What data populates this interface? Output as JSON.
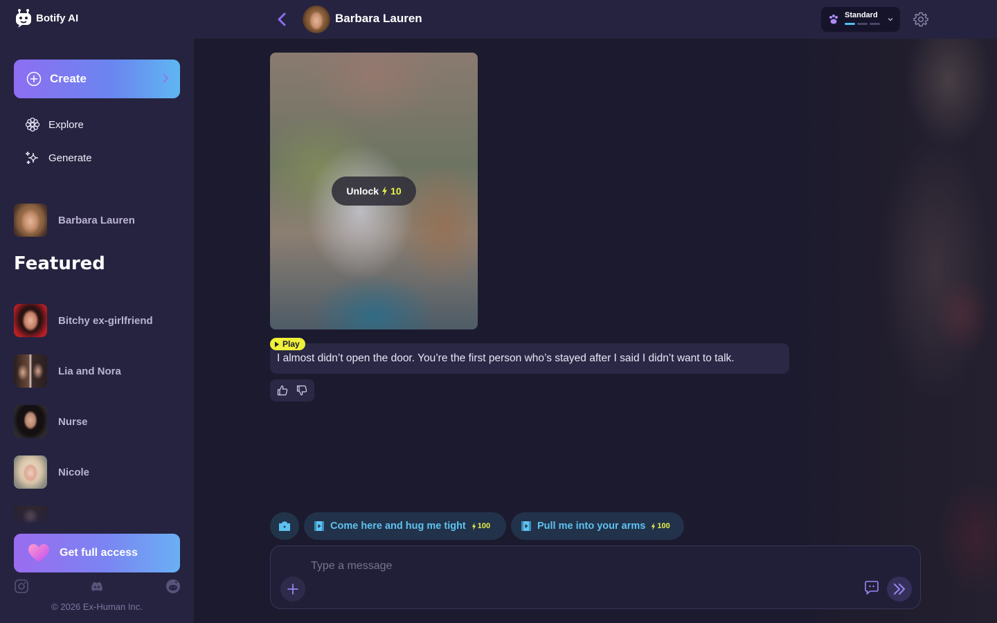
{
  "app": {
    "brand": "Botify AI",
    "copyright": "© 2026 Ex-Human Inc."
  },
  "sidebar": {
    "create_label": "Create",
    "nav": [
      {
        "label": "Explore",
        "icon": "flower-icon"
      },
      {
        "label": "Generate",
        "icon": "sparkle-icon"
      }
    ],
    "recent": [
      {
        "name": "Barbara Lauren"
      }
    ],
    "featured_title": "Featured",
    "featured": [
      {
        "name": "Bitchy ex-girlfriend"
      },
      {
        "name": "Lia and Nora"
      },
      {
        "name": "Nurse"
      },
      {
        "name": "Nicole"
      }
    ],
    "access_label": "Get full access",
    "socials": [
      "instagram-icon",
      "discord-icon",
      "reddit-icon"
    ]
  },
  "header": {
    "character_name": "Barbara Lauren",
    "model": {
      "name": "Standard",
      "level": 1,
      "max_level": 3
    }
  },
  "chat": {
    "media": {
      "unlock_label": "Unlock",
      "unlock_cost": "10"
    },
    "play_label": "Play",
    "message": "I almost didn’t open the door. You’re the first person who’s stayed after I said I didn’t want to talk."
  },
  "suggestions": [
    {
      "label": "Come here and hug me tight",
      "cost": "100"
    },
    {
      "label": "Pull me into your arms",
      "cost": "100"
    }
  ],
  "composer": {
    "placeholder": "Type a message"
  },
  "colors": {
    "accent": "#8d6ef2",
    "cost": "#e8f24a",
    "suggestion_text": "#5ec2f0",
    "background": "#1c1a2e",
    "sidebar": "#262340"
  }
}
